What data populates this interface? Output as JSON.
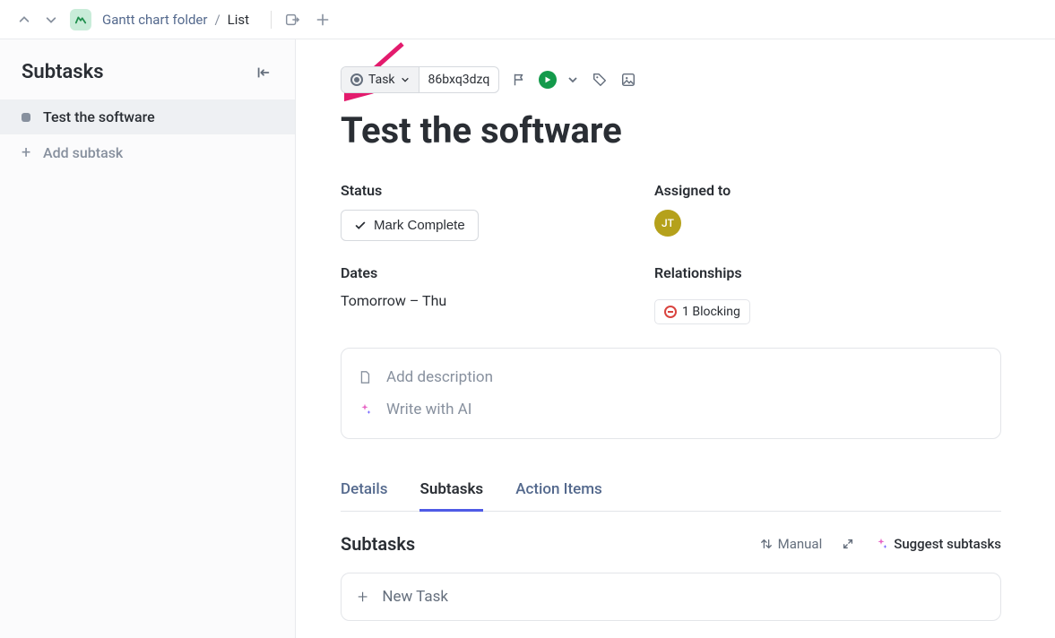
{
  "breadcrumb": {
    "folder": "Gantt chart folder",
    "current": "List"
  },
  "sidebar": {
    "title": "Subtasks",
    "active_item": "Test the software",
    "add_label": "Add subtask"
  },
  "task": {
    "type_label": "Task",
    "id": "86bxq3dzq",
    "title": "Test the software",
    "status_label": "Status",
    "status_button": "Mark Complete",
    "assigned_label": "Assigned to",
    "assignee_initials": "JT",
    "dates_label": "Dates",
    "dates_value": "Tomorrow – Thu",
    "relationships_label": "Relationships",
    "blocking_text": "1 Blocking",
    "desc_placeholder": "Add description",
    "ai_label": "Write with AI"
  },
  "tabs": {
    "details": "Details",
    "subtasks": "Subtasks",
    "action_items": "Action Items"
  },
  "subtask_section": {
    "title": "Subtasks",
    "sort_label": "Manual",
    "suggest_label": "Suggest subtasks",
    "new_task_label": "New Task"
  }
}
